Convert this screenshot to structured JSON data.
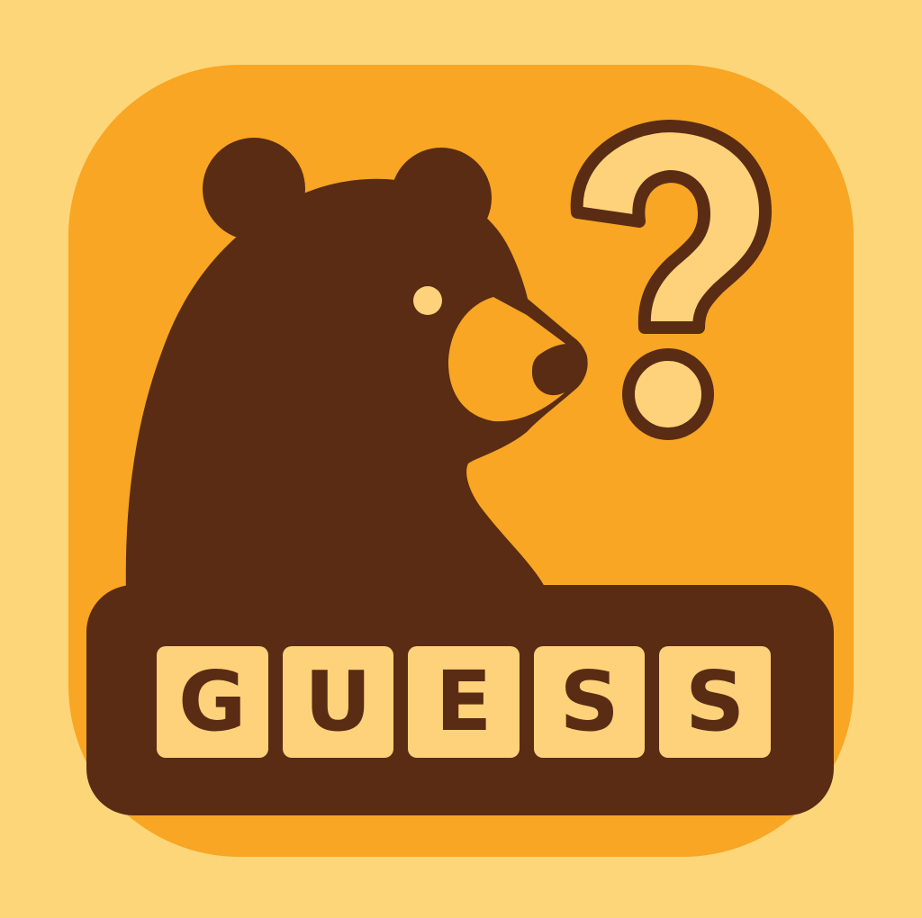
{
  "app_icon": {
    "name": "Bear Guess",
    "word_tiles": [
      "G",
      "U",
      "E",
      "S",
      "S"
    ],
    "icons": [
      "bear-silhouette-icon",
      "question-mark-icon"
    ],
    "colors": {
      "background": "#FDD679",
      "tile": "#F8A623",
      "bear": "#5A2C14",
      "letter_tile": "#FDD27A",
      "question_fill": "#FDD27A",
      "question_outline": "#5A2C14"
    }
  }
}
